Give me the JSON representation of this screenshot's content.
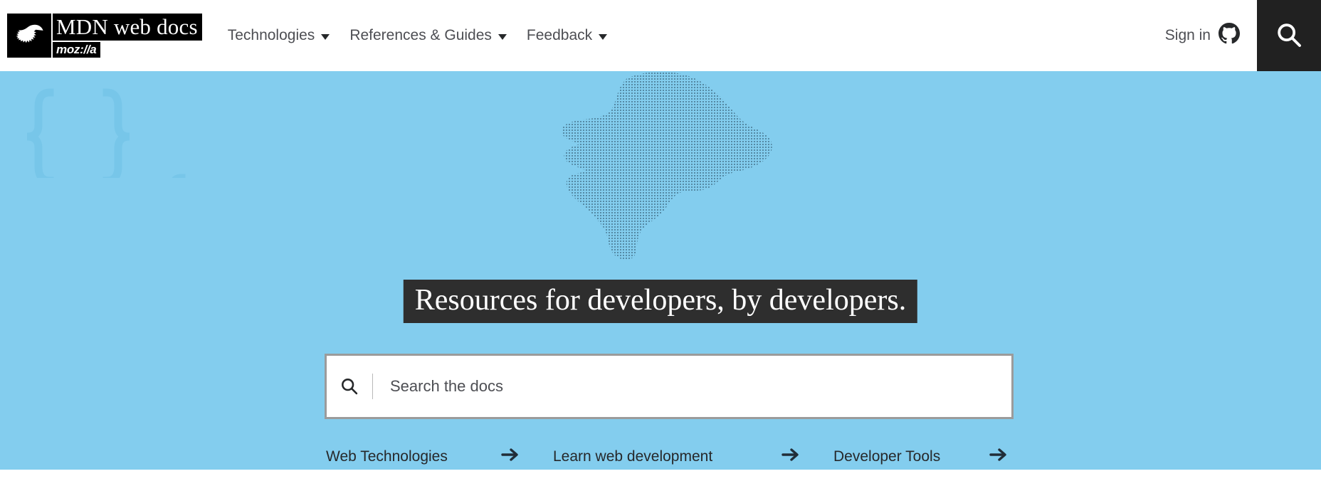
{
  "site": {
    "logo_wordmark": "MDN web docs",
    "logo_sub": "moz://a",
    "logo_icon": "dinosaur-head-icon"
  },
  "header": {
    "nav": [
      {
        "label": "Technologies",
        "icon": "chevron-down-icon"
      },
      {
        "label": "References & Guides",
        "icon": "chevron-down-icon"
      },
      {
        "label": "Feedback",
        "icon": "chevron-down-icon"
      }
    ],
    "signin_label": "Sign in",
    "signin_icon": "github-icon",
    "search_button_icon": "search-icon"
  },
  "hero": {
    "headline": "Resources for developers, by developers.",
    "background_icon": "halftone-dinosaur-head",
    "search": {
      "icon": "search-icon",
      "placeholder": "Search the docs",
      "value": ""
    },
    "quick_links": [
      {
        "label": "Web Technologies",
        "icon": "arrow-right-icon"
      },
      {
        "label": "Learn web development",
        "icon": "arrow-right-icon"
      },
      {
        "label": "Developer Tools",
        "icon": "arrow-right-icon"
      }
    ]
  },
  "colors": {
    "hero_background": "#83cdee",
    "headline_background": "#2e2e2e",
    "header_search_button": "#212121",
    "quicklink_underline": "#212d38",
    "logo_background": "#000000",
    "text": "#4d4e53"
  }
}
